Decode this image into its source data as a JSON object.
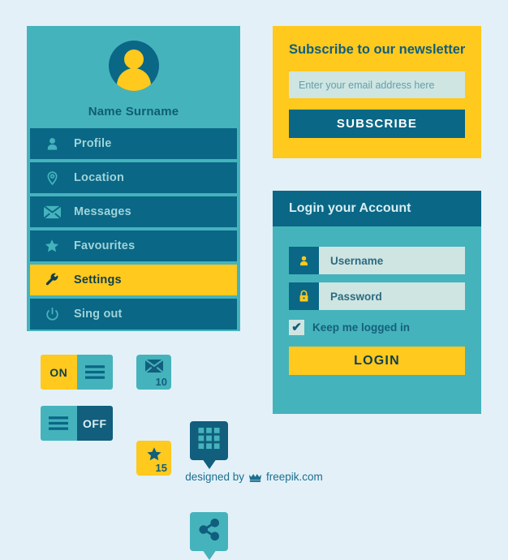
{
  "theme": {
    "background": "#E3F0F8",
    "teal": "#45B3BC",
    "dark_teal": "#0A6786",
    "navy": "#115E7D",
    "yellow": "#FFC91D",
    "mint_input": "#CFE5E2"
  },
  "sidebar": {
    "profile_name": "Name Surname",
    "avatar_icon": "user-avatar-icon",
    "items": [
      {
        "label": "Profile",
        "icon": "person-icon",
        "active": false
      },
      {
        "label": "Location",
        "icon": "map-pin-icon",
        "active": false
      },
      {
        "label": "Messages",
        "icon": "envelope-icon",
        "active": false
      },
      {
        "label": "Favourites",
        "icon": "star-icon",
        "active": false
      },
      {
        "label": "Settings",
        "icon": "wrench-icon",
        "active": true
      },
      {
        "label": "Sing out",
        "icon": "power-icon",
        "active": false
      }
    ]
  },
  "newsletter": {
    "title": "Subscribe to our newsletter",
    "email_placeholder": "Enter your email address here",
    "email_value": "",
    "submit_label": "SUBSCRIBE"
  },
  "login": {
    "title": "Login your Account",
    "username_label": "Username",
    "username_icon": "person-icon",
    "password_label": "Password",
    "password_icon": "lock-icon",
    "keep_logged_label": "Keep me logged in",
    "keep_logged_checked": true,
    "checkbox_glyph": "✔",
    "submit_label": "LOGIN"
  },
  "widgets": {
    "toggle_on": {
      "label": "ON",
      "icon": "hamburger-icon",
      "state": "on"
    },
    "toggle_off": {
      "label": "OFF",
      "icon": "hamburger-icon",
      "state": "off"
    },
    "tile_messages": {
      "count": "10",
      "icon": "envelope-icon"
    },
    "tile_favourites": {
      "count": "15",
      "icon": "star-icon"
    },
    "bubble_grid": {
      "icon": "grid-icon"
    },
    "bubble_share": {
      "icon": "share-icon"
    }
  },
  "footer": {
    "credit_prefix": "designed by",
    "credit_brand": "freepik.com",
    "crown_icon": "crown-icon"
  }
}
